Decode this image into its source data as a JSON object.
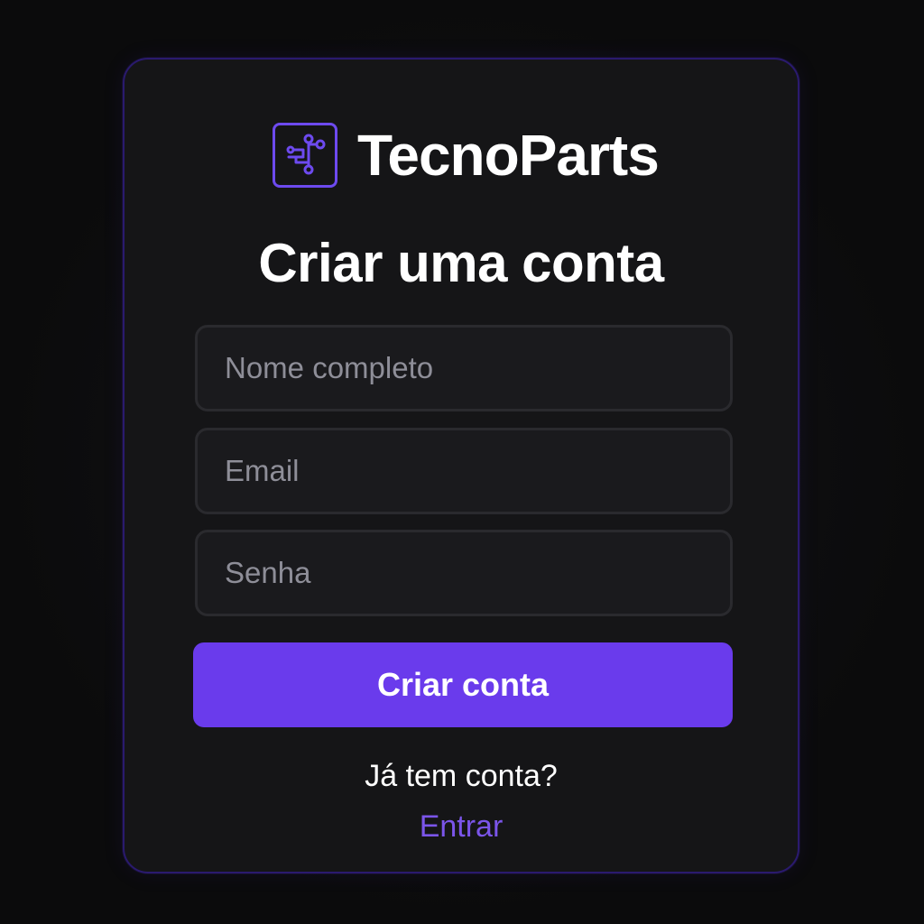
{
  "brand": {
    "name": "TecnoParts",
    "logo_icon": "circuit-icon",
    "accent_color": "#6a3bec"
  },
  "form": {
    "title": "Criar uma conta",
    "fields": [
      {
        "name": "full-name",
        "placeholder": "Nome completo",
        "value": ""
      },
      {
        "name": "email",
        "placeholder": "Email",
        "value": ""
      },
      {
        "name": "password",
        "placeholder": "Senha",
        "value": ""
      }
    ],
    "submit_label": "Criar conta"
  },
  "footer": {
    "question": "Já tem conta?",
    "login_link": "Entrar",
    "link_color": "#7b55ea"
  }
}
